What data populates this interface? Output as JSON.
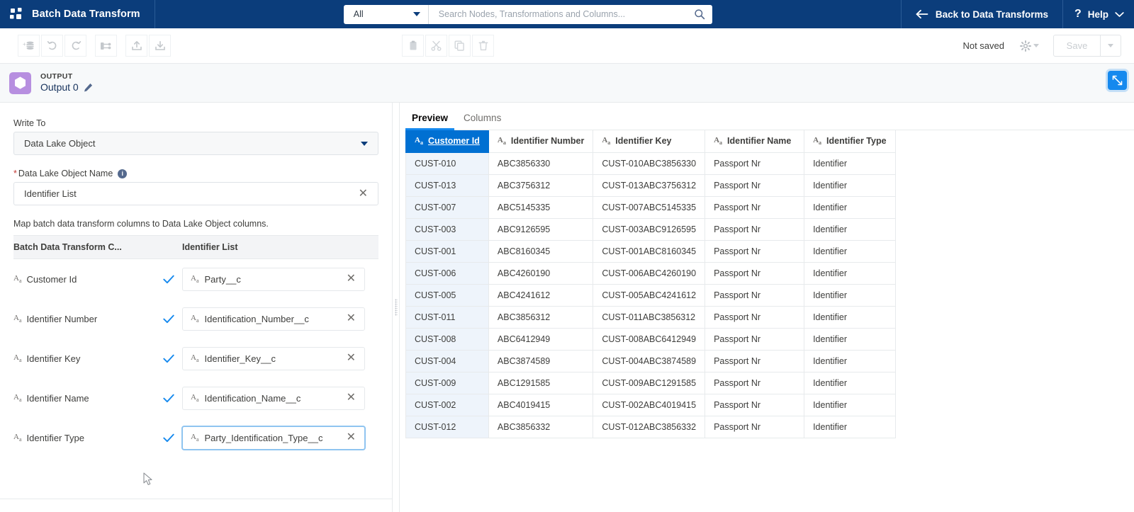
{
  "header": {
    "brand_title": "Batch Data Transform",
    "logo_icon": "pinwheel-logo-icon",
    "search_scope": "All",
    "search_placeholder": "Search Nodes, Transformations and Columns...",
    "search_value": "",
    "search_icon": "search-icon",
    "back_label": "Back to Data Transforms",
    "back_icon": "arrow-left-icon",
    "help_label": "Help",
    "help_icon": "question-mark-icon",
    "help_caret_icon": "chevron-down-icon",
    "brand_bg": "#0b3d7b"
  },
  "toolbar": {
    "buttons": [
      {
        "name": "add-node-button",
        "icon": "add-database-icon"
      },
      {
        "name": "undo-button",
        "icon": "undo-icon"
      },
      {
        "name": "redo-button",
        "icon": "redo-icon"
      },
      {
        "name": "run-flow-button",
        "icon": "flow-branch-icon"
      },
      {
        "name": "upload-button",
        "icon": "upload-icon"
      },
      {
        "name": "download-button",
        "icon": "download-icon"
      },
      {
        "name": "paste-button",
        "icon": "clipboard-icon"
      },
      {
        "name": "cut-button",
        "icon": "scissors-icon"
      },
      {
        "name": "copy-button",
        "icon": "copy-icon"
      },
      {
        "name": "delete-button",
        "icon": "trash-icon"
      }
    ],
    "status_text": "Not saved",
    "settings_icon": "gear-icon",
    "save_label": "Save",
    "save_caret_icon": "chevron-down-icon"
  },
  "node_bar": {
    "kicker": "OUTPUT",
    "name": "Output 0",
    "edit_icon": "pencil-icon",
    "node_icon": "hexagon-output-icon",
    "node_icon_color": "#b78fe0",
    "expand_icon": "expand-diagonal-icon",
    "expand_color": "#1589ee"
  },
  "left_panel": {
    "write_to_label": "Write To",
    "write_to_value": "Data Lake Object",
    "write_to_caret_icon": "chevron-down-icon",
    "object_name_label": "Data Lake Object Name",
    "object_name_required": "*",
    "object_name_info_icon": "info-icon",
    "object_name_value": "Identifier List",
    "object_name_clear_icon": "close-icon",
    "helper_text": "Map batch data transform columns to Data Lake Object columns.",
    "map_header": {
      "source": "Batch Data Transform C...",
      "target": "Identifier List"
    },
    "mappings": [
      {
        "source": "Customer Id",
        "source_type_icon": "text-type-icon",
        "check_icon": "check-icon",
        "target": "Party__c",
        "target_type_icon": "text-type-icon",
        "clear_icon": "close-icon",
        "focused": false
      },
      {
        "source": "Identifier Number",
        "source_type_icon": "text-type-icon",
        "check_icon": "check-icon",
        "target": "Identification_Number__c",
        "target_type_icon": "text-type-icon",
        "clear_icon": "close-icon",
        "focused": false
      },
      {
        "source": "Identifier Key",
        "source_type_icon": "text-type-icon",
        "check_icon": "check-icon",
        "target": "Identifier_Key__c",
        "target_type_icon": "text-type-icon",
        "clear_icon": "close-icon",
        "focused": false
      },
      {
        "source": "Identifier Name",
        "source_type_icon": "text-type-icon",
        "check_icon": "check-icon",
        "target": "Identification_Name__c",
        "target_type_icon": "text-type-icon",
        "clear_icon": "close-icon",
        "focused": false
      },
      {
        "source": "Identifier Type",
        "source_type_icon": "text-type-icon",
        "check_icon": "check-icon",
        "target": "Party_Identification_Type__c",
        "target_type_icon": "text-type-icon",
        "clear_icon": "close-icon",
        "focused": true
      }
    ]
  },
  "right_panel": {
    "tabs": [
      {
        "label": "Preview",
        "active": true
      },
      {
        "label": "Columns",
        "active": false
      }
    ],
    "table": {
      "columns": [
        {
          "label": "Customer Id",
          "type_icon": "text-type-icon",
          "sorted": true
        },
        {
          "label": "Identifier Number",
          "type_icon": "text-type-icon",
          "sorted": false
        },
        {
          "label": "Identifier Key",
          "type_icon": "text-type-icon",
          "sorted": false
        },
        {
          "label": "Identifier Name",
          "type_icon": "text-type-icon",
          "sorted": false
        },
        {
          "label": "Identifier Type",
          "type_icon": "text-type-icon",
          "sorted": false
        }
      ],
      "rows": [
        [
          "CUST-010",
          "ABC3856330",
          "CUST-010ABC3856330",
          "Passport Nr",
          "Identifier"
        ],
        [
          "CUST-013",
          "ABC3756312",
          "CUST-013ABC3756312",
          "Passport Nr",
          "Identifier"
        ],
        [
          "CUST-007",
          "ABC5145335",
          "CUST-007ABC5145335",
          "Passport Nr",
          "Identifier"
        ],
        [
          "CUST-003",
          "ABC9126595",
          "CUST-003ABC9126595",
          "Passport Nr",
          "Identifier"
        ],
        [
          "CUST-001",
          "ABC8160345",
          "CUST-001ABC8160345",
          "Passport Nr",
          "Identifier"
        ],
        [
          "CUST-006",
          "ABC4260190",
          "CUST-006ABC4260190",
          "Passport Nr",
          "Identifier"
        ],
        [
          "CUST-005",
          "ABC4241612",
          "CUST-005ABC4241612",
          "Passport Nr",
          "Identifier"
        ],
        [
          "CUST-011",
          "ABC3856312",
          "CUST-011ABC3856312",
          "Passport Nr",
          "Identifier"
        ],
        [
          "CUST-008",
          "ABC6412949",
          "CUST-008ABC6412949",
          "Passport Nr",
          "Identifier"
        ],
        [
          "CUST-004",
          "ABC3874589",
          "CUST-004ABC3874589",
          "Passport Nr",
          "Identifier"
        ],
        [
          "CUST-009",
          "ABC1291585",
          "CUST-009ABC1291585",
          "Passport Nr",
          "Identifier"
        ],
        [
          "CUST-002",
          "ABC4019415",
          "CUST-002ABC4019415",
          "Passport Nr",
          "Identifier"
        ],
        [
          "CUST-012",
          "ABC3856332",
          "CUST-012ABC3856332",
          "Passport Nr",
          "Identifier"
        ]
      ]
    }
  },
  "splitter": {
    "grip_icon": "drag-grip-icon"
  },
  "cursor": {
    "icon": "mouse-pointer-icon"
  }
}
